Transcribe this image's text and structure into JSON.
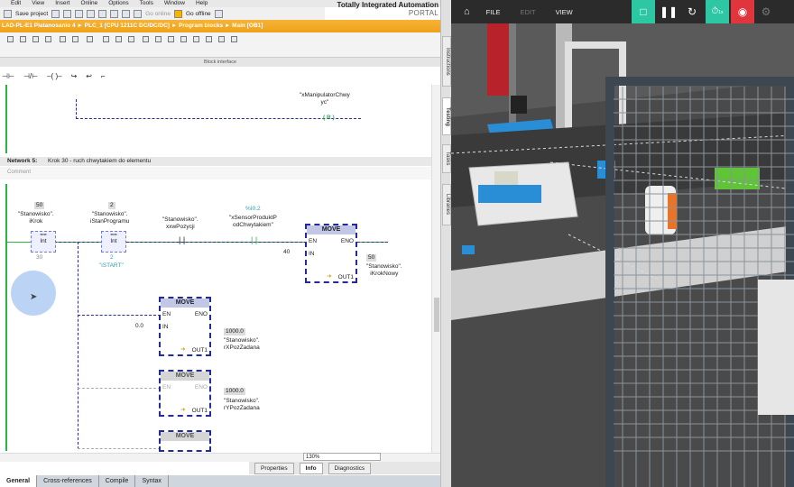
{
  "tia": {
    "menu": [
      "Edit",
      "View",
      "Insert",
      "Online",
      "Options",
      "Tools",
      "Window",
      "Help"
    ],
    "title": "Totally Integrated Automation",
    "portal": "PORTAL",
    "toolbar": {
      "save_label": "Save project",
      "go_online": "Go online",
      "go_offline": "Go offline"
    },
    "breadcrumb": "LAD-PL-E1 Platanosanio 4  ►  PLC_1 [CPU 1211C DC/DC/DC]  ►  Program blocks  ►  Main [OB1]",
    "block_interface": "Block interface",
    "lad_tools": [
      "⊣⊢",
      "⊣/⊢",
      "–( )–",
      "↪",
      "↩",
      "⌐"
    ],
    "network_top": {
      "coil_var": "\"xManipulatorChwy\nyc\"",
      "coil_symbol": "( R )"
    },
    "network5": {
      "title": "Network 5:",
      "desc": "Krok 30 - ruch chwytakiem do elementu",
      "comment": "Comment",
      "cmp1": {
        "value": "50",
        "var": "\"Stanowisko\".\niKrok",
        "op": "==",
        "type": "Int",
        "operand": "30"
      },
      "cmp2": {
        "value": "2",
        "var": "\"Stanowisko\".\niStanProgramu",
        "op": "==",
        "type": "Int",
        "operand": "2",
        "operand_name": "\"iSTART\""
      },
      "contact1": {
        "var": "\"Stanowisko\".\nxxwPozycji"
      },
      "contact2": {
        "addr": "%I0.2",
        "var": "\"xSensorProduktP\nodChwytakiem\""
      },
      "move1": {
        "title": "MOVE",
        "en": "EN",
        "eno": "ENO",
        "in_label": "IN",
        "in_value": "40",
        "out_label": "OUT1",
        "out_value": "50",
        "out_var": "\"Stanowisko\".\niKrokNowy"
      },
      "move2": {
        "title": "MOVE",
        "en": "EN",
        "eno": "ENO",
        "in_label": "IN",
        "in_value": "0.0",
        "out_label": "OUT1",
        "out_value": "1000.0",
        "out_var": "\"Stanowisko\".\nrXPozZadana"
      },
      "move3": {
        "title": "MOVE",
        "en": "EN",
        "eno": "ENO",
        "out_label": "OUT1",
        "out_value": "1000.0",
        "out_var": "\"Stanowisko\".\nrYPozZadana"
      },
      "move4": {
        "title": "MOVE"
      }
    },
    "zoom": "130%",
    "props_tabs": [
      "Properties",
      "Info",
      "Diagnostics"
    ],
    "props_active": "Info",
    "bottom_tabs": [
      "General",
      "Cross-references",
      "Compile",
      "Syntax"
    ],
    "bottom_active": "General",
    "side_tabs": [
      "Instructions",
      "Testing",
      "Tasks",
      "Libraries"
    ],
    "side_active": "Testing"
  },
  "sim": {
    "menu": [
      "FILE",
      "EDIT",
      "VIEW"
    ],
    "speed_label": "1x",
    "colors": {
      "accent": "#2ec7a4",
      "record": "#e0353d",
      "box_blue": "#2a8ed6",
      "box_green": "#5fc436",
      "arm_red": "#b8222a"
    }
  }
}
